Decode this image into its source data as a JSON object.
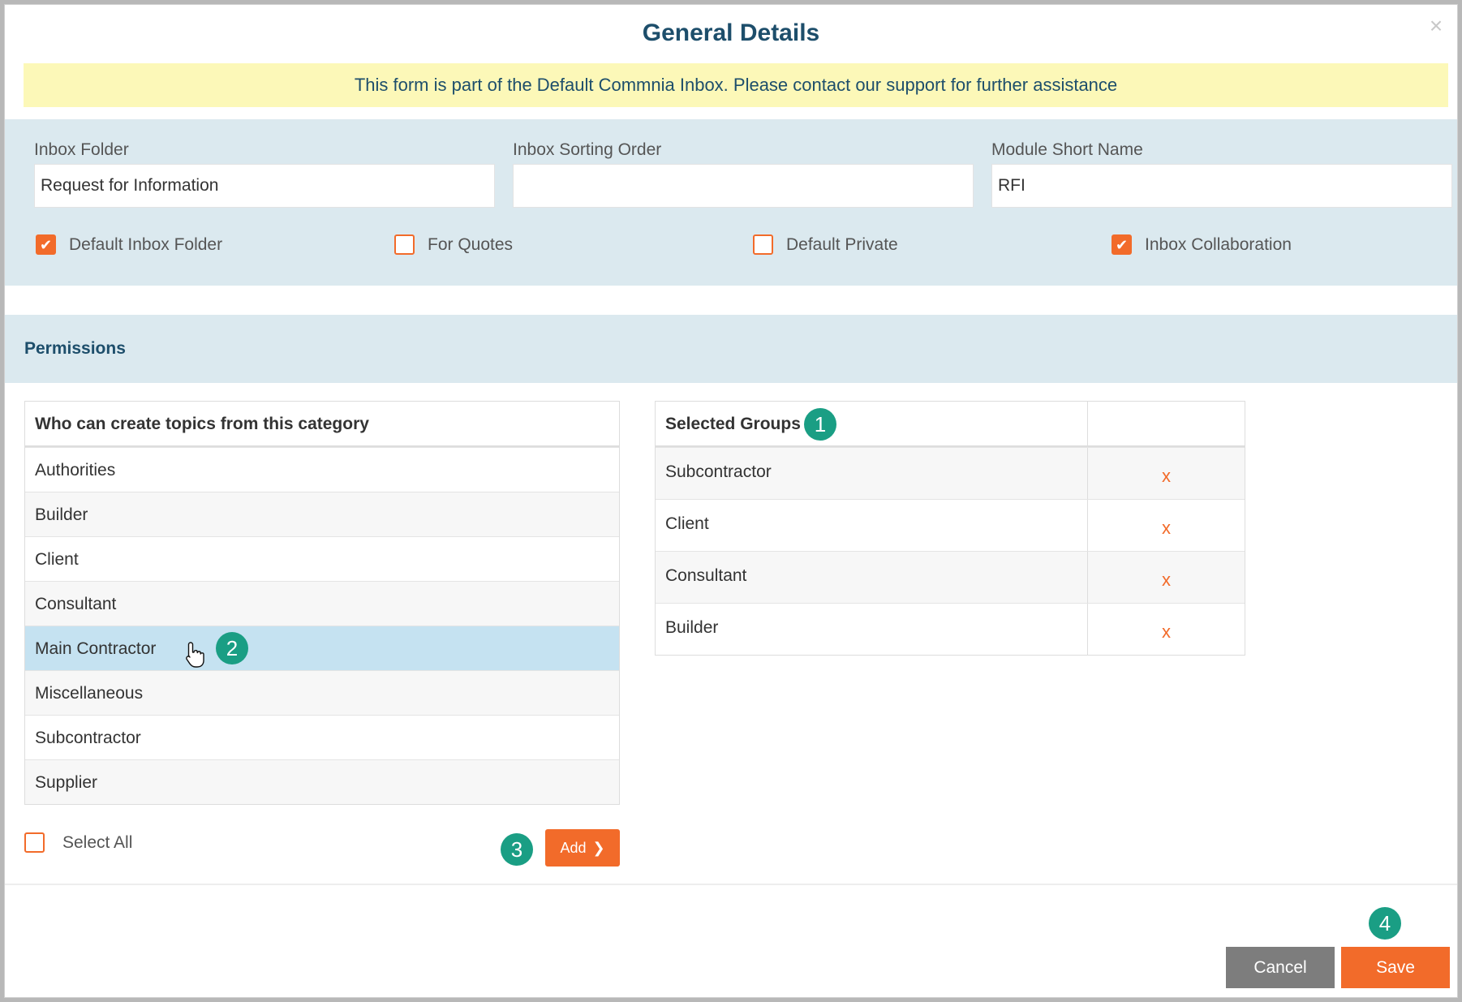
{
  "modal": {
    "title": "General Details",
    "close_icon": "close-icon",
    "notice": "This form is part of the Default Commnia Inbox. Please contact our support for further assistance"
  },
  "fields": {
    "inbox_folder": {
      "label": "Inbox Folder",
      "value": "Request for Information"
    },
    "sorting_order": {
      "label": "Inbox Sorting Order",
      "value": ""
    },
    "module_short_name": {
      "label": "Module Short Name",
      "value": "RFI"
    }
  },
  "checkboxes": [
    {
      "label": "Default Inbox Folder",
      "checked": true
    },
    {
      "label": "For Quotes",
      "checked": false
    },
    {
      "label": "Default Private",
      "checked": false
    },
    {
      "label": "Inbox Collaboration",
      "checked": true
    }
  ],
  "permissions": {
    "title": "Permissions",
    "available_header": "Who can create topics from this category",
    "available": [
      "Authorities",
      "Builder",
      "Client",
      "Consultant",
      "Main Contractor",
      "Miscellaneous",
      "Subcontractor",
      "Supplier"
    ],
    "active_index": 4,
    "selected_header": "Selected Groups",
    "selected": [
      "Subcontractor",
      "Client",
      "Consultant",
      "Builder"
    ],
    "remove_label": "x",
    "select_all_label": "Select All",
    "add_label": "Add"
  },
  "callouts": [
    "1",
    "2",
    "3",
    "4"
  ],
  "footer": {
    "cancel_label": "Cancel",
    "save_label": "Save"
  },
  "colors": {
    "accent": "#f26b2a",
    "heading": "#1d4e6b",
    "panel": "#dbe9ef",
    "badge": "#1a9e84",
    "notice_bg": "#fcf8b8"
  }
}
